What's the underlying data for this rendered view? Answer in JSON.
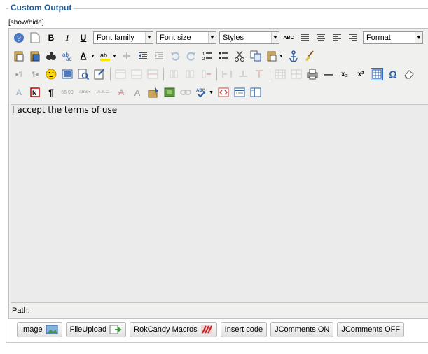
{
  "legend": "Custom Output",
  "show_hide": "[show/hide]",
  "toolbar": {
    "font_family": "Font family",
    "font_size": "Font size",
    "styles": "Styles",
    "format": "Format",
    "bold": "B",
    "italic": "I",
    "underline": "U",
    "strike": "ABC",
    "pilcrow": "¶",
    "omega": "Ω",
    "subscript": "x₂",
    "superscript": "x²",
    "hr": "—",
    "textcolor": "A",
    "abbr_a": "ABBR",
    "abbr_b": "A.B.C.",
    "strike_a": "A",
    "cite": "66 99"
  },
  "editor": {
    "content": "I accept the terms of use",
    "path_label": "Path:"
  },
  "buttons": [
    {
      "label": "Image"
    },
    {
      "label": "FileUpload"
    },
    {
      "label": "RokCandy Macros"
    },
    {
      "label": "Insert code"
    },
    {
      "label": "JComments ON"
    },
    {
      "label": "JComments OFF"
    }
  ],
  "colors": {
    "legend": "#1f5d9e",
    "editor_bg": "#f0f0ee",
    "content_bg": "#ebebeb",
    "icon_blue": "#2a5ea8",
    "active_btn": "#c1d2ee"
  }
}
